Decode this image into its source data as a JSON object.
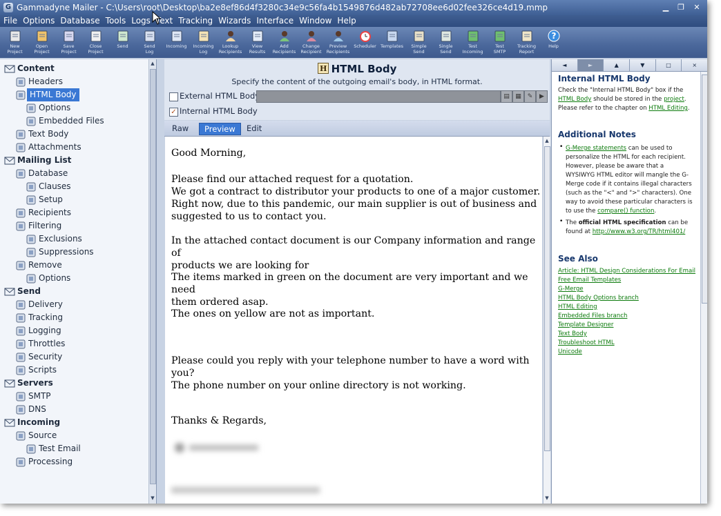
{
  "titlebar": {
    "title": "Gammadyne Mailer - C:\\Users\\root\\Desktop\\ba2e8ef86d4f3280c34e9c56fa4b1549876d482ab72708ee6d02fee326ce4d19.mmp",
    "icon": "mailer-app-icon"
  },
  "menu": [
    "File",
    "Options",
    "Database",
    "Tools",
    "Logs",
    "Text",
    "Tracking",
    "Wizards",
    "Interface",
    "Window",
    "Help"
  ],
  "toolbar": [
    {
      "label": "New\nProject",
      "icon": "new-project-icon"
    },
    {
      "label": "Open\nProject",
      "icon": "open-project-icon"
    },
    {
      "label": "Save\nProject",
      "icon": "save-project-icon"
    },
    {
      "label": "Close\nProject",
      "icon": "close-project-icon"
    },
    {
      "label": "Send",
      "icon": "send-icon"
    },
    {
      "label": "Send\nLog",
      "icon": "send-log-icon"
    },
    {
      "label": "Incoming",
      "icon": "incoming-icon"
    },
    {
      "label": "Incoming\nLog",
      "icon": "incoming-log-icon"
    },
    {
      "label": "Lookup\nRecipients",
      "icon": "lookup-recipients-icon"
    },
    {
      "label": "View\nResults",
      "icon": "view-results-icon"
    },
    {
      "label": "Add\nRecipients",
      "icon": "add-recipients-icon"
    },
    {
      "label": "Change\nRecipient",
      "icon": "change-recipient-icon"
    },
    {
      "label": "Preview\nRecipients",
      "icon": "preview-recipients-icon"
    },
    {
      "label": "Scheduler",
      "icon": "scheduler-icon"
    },
    {
      "label": "Templates",
      "icon": "templates-icon"
    },
    {
      "label": "Simple\nSend",
      "icon": "simple-send-icon"
    },
    {
      "label": "Single\nSend",
      "icon": "single-send-icon"
    },
    {
      "label": "Test\nIncoming",
      "icon": "test-incoming-icon"
    },
    {
      "label": "Test\nSMTP",
      "icon": "test-smtp-icon"
    },
    {
      "label": "Tracking\nReport",
      "icon": "tracking-report-icon"
    },
    {
      "label": "Help",
      "icon": "help-icon"
    }
  ],
  "tree": [
    {
      "label": "Content",
      "level": 0,
      "header": true,
      "icon": "content-envelope-icon"
    },
    {
      "label": "Headers",
      "level": 1,
      "icon": "headers-icon"
    },
    {
      "label": "HTML Body",
      "level": 1,
      "icon": "html-body-icon",
      "selected": true
    },
    {
      "label": "Options",
      "level": 2,
      "icon": "options-icon"
    },
    {
      "label": "Embedded Files",
      "level": 2,
      "icon": "embedded-files-icon"
    },
    {
      "label": "Text Body",
      "level": 1,
      "icon": "text-body-icon"
    },
    {
      "label": "Attachments",
      "level": 1,
      "icon": "paperclip-icon"
    },
    {
      "label": "Mailing List",
      "level": 0,
      "header": true,
      "icon": "mailing-list-icon"
    },
    {
      "label": "Database",
      "level": 1,
      "icon": "database-icon"
    },
    {
      "label": "Clauses",
      "level": 2,
      "icon": "clauses-icon"
    },
    {
      "label": "Setup",
      "level": 2,
      "icon": "setup-icon"
    },
    {
      "label": "Recipients",
      "level": 1,
      "icon": "recipients-icon"
    },
    {
      "label": "Filtering",
      "level": 1,
      "icon": "filter-icon"
    },
    {
      "label": "Exclusions",
      "level": 2,
      "icon": "exclusions-icon"
    },
    {
      "label": "Suppressions",
      "level": 2,
      "icon": "suppressions-icon"
    },
    {
      "label": "Remove",
      "level": 1,
      "icon": "remove-icon"
    },
    {
      "label": "Options",
      "level": 2,
      "icon": "options-icon"
    },
    {
      "label": "Send",
      "level": 0,
      "header": true,
      "icon": "send-envelope-icon"
    },
    {
      "label": "Delivery",
      "level": 1,
      "icon": "delivery-icon"
    },
    {
      "label": "Tracking",
      "level": 1,
      "icon": "tracking-icon"
    },
    {
      "label": "Logging",
      "level": 1,
      "icon": "logging-icon"
    },
    {
      "label": "Throttles",
      "level": 1,
      "icon": "throttles-icon"
    },
    {
      "label": "Security",
      "level": 1,
      "icon": "security-icon"
    },
    {
      "label": "Scripts",
      "level": 1,
      "icon": "scripts-icon"
    },
    {
      "label": "Servers",
      "level": 0,
      "header": true,
      "icon": "servers-icon"
    },
    {
      "label": "SMTP",
      "level": 1,
      "icon": "smtp-icon"
    },
    {
      "label": "DNS",
      "level": 1,
      "icon": "dns-globe-icon"
    },
    {
      "label": "Incoming",
      "level": 0,
      "header": true,
      "icon": "incoming-envelope-icon"
    },
    {
      "label": "Source",
      "level": 1,
      "icon": "source-icon"
    },
    {
      "label": "Test Email",
      "level": 2,
      "icon": "test-email-icon"
    },
    {
      "label": "Processing",
      "level": 1,
      "icon": "processing-icon"
    }
  ],
  "panel": {
    "title": "HTML Body",
    "subtitle": "Specify the content of the outgoing email's body, in HTML format.",
    "external_label": "External HTML Body:",
    "external_checked": false,
    "internal_label": "Internal HTML Body",
    "internal_checked": true,
    "tabs": [
      "Raw",
      "Preview",
      "Edit"
    ],
    "active_tab": "Preview"
  },
  "email_body": [
    "Good Morning,",
    "Please find our attached request for a quotation.\nWe got a contract to distributor your products to one of a major customer.\nRight now, due to this pandemic, our main supplier is out of business and\nsuggested to us to contact you.",
    "In the attached contact document is our Company information and range of\nproducts we are looking for",
    "The items marked in green on the document are very important and we need\nthem ordered asap.",
    "The ones on yellow are not as important.",
    "Please could you reply with your telephone number to have a word with you?\nThe phone number on your online directory is not working.",
    "Thanks & Regards,"
  ],
  "help": {
    "nav": [
      "◄",
      "►",
      "▲",
      "▼",
      "□",
      "×"
    ],
    "heading1": "Internal HTML Body",
    "p1_a": "Check the \"Internal HTML Body\" box if the ",
    "p1_link1": "HTML Body",
    "p1_b": " should be stored in the ",
    "p1_link2": "project",
    "p1_c": ".  Please refer to the chapter on ",
    "p1_link3": "HTML Editing",
    "p1_d": ".",
    "heading2": "Additional Notes",
    "b1_link": "G-Merge statements",
    "b1_text": " can be used to personalize the HTML for each recipient. However, please be aware that a WYSIWYG HTML editor will mangle the G-Merge code if it contains illegal characters (such as the \"<\" and \">\" characters).  One way to avoid these particular characters is to use the ",
    "b1_link2": "compare() function",
    "b1_end": ".",
    "b2_a": "The ",
    "b2_bold": "official HTML specification",
    "b2_b": " can be found at ",
    "b2_link": "http://www.w3.org/TR/html401/",
    "heading3": "See Also",
    "see_also": [
      "Article: HTML Design Considerations For Email",
      "Free Email Templates",
      "G-Merge",
      "HTML Body Options branch",
      "HTML Editing",
      "Embedded Files branch",
      "Template Designer",
      "Text Body",
      "Troubleshoot HTML",
      "Unicode"
    ]
  }
}
